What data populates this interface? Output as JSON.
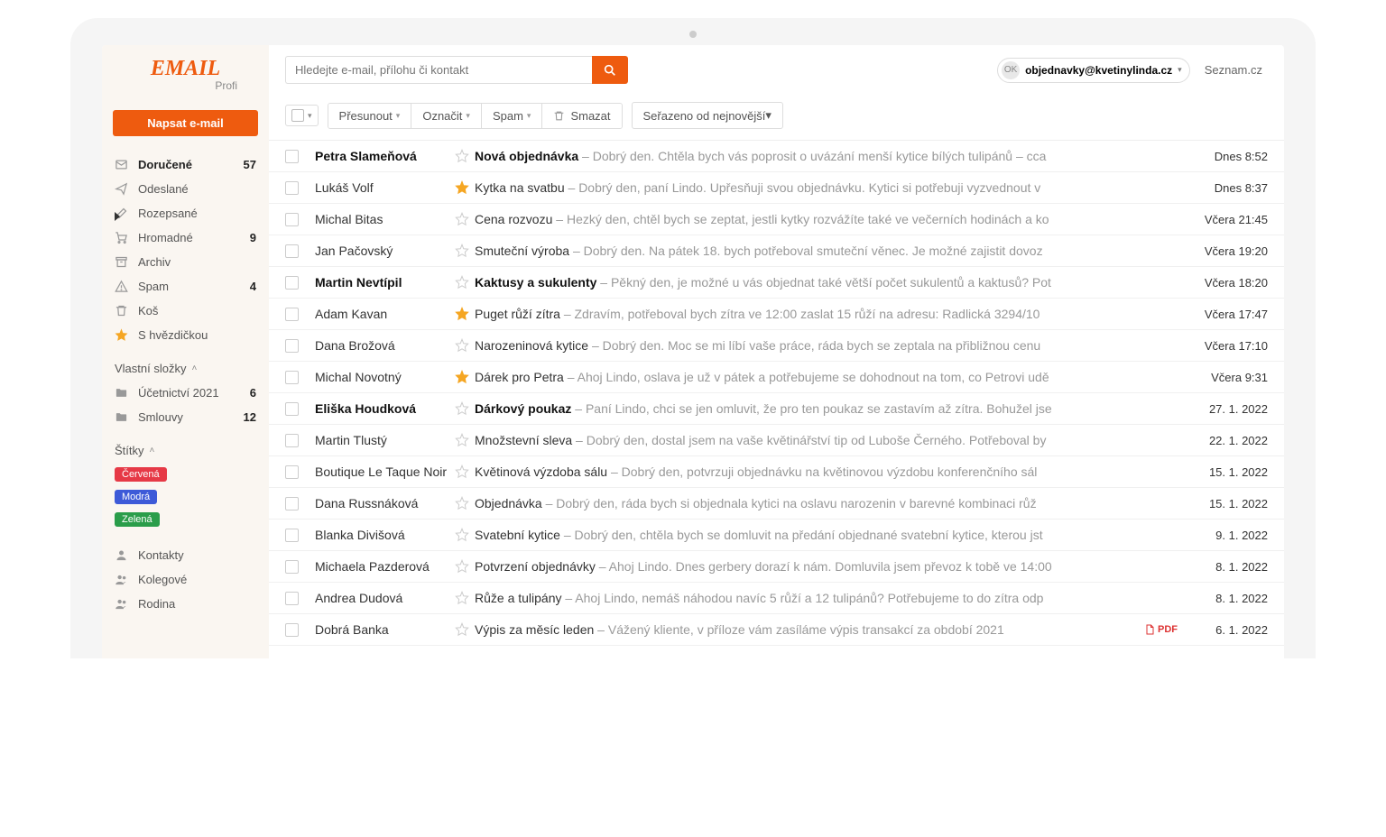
{
  "logo": {
    "main": "EMAIL",
    "sub": "Profi"
  },
  "compose": "Napsat e-mail",
  "search": {
    "placeholder": "Hledejte e-mail, přílohu či kontakt"
  },
  "account": {
    "badge": "OK",
    "email": "objednavky@kvetinylinda.cz"
  },
  "brand_link": "Seznam.cz",
  "toolbar": {
    "move": "Přesunout",
    "mark": "Označit",
    "spam": "Spam",
    "delete": "Smazat",
    "sort": "Seřazeno od nejnovější"
  },
  "folders": [
    {
      "icon": "inbox",
      "label": "Doručené",
      "count": "57",
      "active": true
    },
    {
      "icon": "sent",
      "label": "Odeslané"
    },
    {
      "icon": "draft",
      "label": "Rozepsané"
    },
    {
      "icon": "bulk",
      "label": "Hromadné",
      "count": "9"
    },
    {
      "icon": "archive",
      "label": "Archiv"
    },
    {
      "icon": "spam",
      "label": "Spam",
      "count": "4"
    },
    {
      "icon": "trash",
      "label": "Koš"
    },
    {
      "icon": "star",
      "label": "S hvězdičkou"
    }
  ],
  "custom_folders_head": "Vlastní složky",
  "custom_folders": [
    {
      "label": "Účetnictví 2021",
      "count": "6"
    },
    {
      "label": "Smlouvy",
      "count": "12"
    }
  ],
  "tags_head": "Štítky",
  "tags": [
    {
      "label": "Červená",
      "color": "#e63946"
    },
    {
      "label": "Modrá",
      "color": "#3d5ad8"
    },
    {
      "label": "Zelená",
      "color": "#2a9d4a"
    }
  ],
  "groups": [
    {
      "icon": "person",
      "label": "Kontakty"
    },
    {
      "icon": "people",
      "label": "Kolegové"
    },
    {
      "icon": "people",
      "label": "Rodina"
    }
  ],
  "emails": [
    {
      "sender": "Petra Slameňová",
      "subject": "Nová objednávka",
      "preview": "Dobrý den. Chtěla bych vás poprosit o uvázání menší kytice bílých tulipánů – cca",
      "date": "Dnes 8:52",
      "unread": true,
      "starred": false
    },
    {
      "sender": "Lukáš Volf",
      "subject": "Kytka na svatbu",
      "preview": "Dobrý den, paní Lindo. Upřesňuji svou objednávku. Kytici si potřebuji vyzvednout v",
      "date": "Dnes 8:37",
      "unread": false,
      "starred": true
    },
    {
      "sender": "Michal Bitas",
      "subject": "Cena rozvozu",
      "preview": "Hezký den, chtěl bych se zeptat, jestli kytky rozvážíte také ve večerních hodinách a ko",
      "date": "Včera 21:45",
      "unread": false,
      "starred": false
    },
    {
      "sender": "Jan Pačovský",
      "subject": "Smuteční výroba",
      "preview": "Dobrý den. Na pátek 18. bych potřeboval smuteční věnec. Je možné zajistit dovoz",
      "date": "Včera 19:20",
      "unread": false,
      "starred": false
    },
    {
      "sender": "Martin Nevtípil",
      "subject": "Kaktusy a sukulenty",
      "preview": "Pěkný den, je možné u vás objednat také větší počet sukulentů a kaktusů? Pot",
      "date": "Včera 18:20",
      "unread": true,
      "starred": false
    },
    {
      "sender": "Adam Kavan",
      "subject": "Puget růží zítra",
      "preview": "Zdravím, potřeboval bych zítra ve 12:00 zaslat 15 růží na adresu: Radlická 3294/10",
      "date": "Včera 17:47",
      "unread": false,
      "starred": true
    },
    {
      "sender": "Dana Brožová",
      "subject": "Narozeninová kytice",
      "preview": "Dobrý den. Moc se mi líbí vaše práce, ráda bych se zeptala na přibližnou cenu",
      "date": "Včera 17:10",
      "unread": false,
      "starred": false
    },
    {
      "sender": "Michal Novotný",
      "subject": "Dárek pro Petra",
      "preview": "Ahoj Lindo, oslava je už v pátek a potřebujeme se dohodnout na tom, co Petrovi udě",
      "date": "Včera 9:31",
      "unread": false,
      "starred": true
    },
    {
      "sender": "Eliška Houdková",
      "subject": "Dárkový poukaz",
      "preview": "Paní Lindo, chci se jen omluvit, že pro ten poukaz se zastavím až zítra. Bohužel jse",
      "date": "27. 1. 2022",
      "unread": true,
      "starred": false
    },
    {
      "sender": "Martin Tlustý",
      "subject": "Množstevní sleva",
      "preview": "Dobrý den, dostal jsem na vaše květinářství tip od Luboše Černého. Potřeboval by",
      "date": "22. 1. 2022",
      "unread": false,
      "starred": false
    },
    {
      "sender": "Boutique Le Taque Noir",
      "subject": "Květinová výzdoba sálu",
      "preview": "Dobrý den, potvrzuji objednávku na květinovou výzdobu konferenčního sál",
      "date": "15. 1. 2022",
      "unread": false,
      "starred": false
    },
    {
      "sender": "Dana Russnáková",
      "subject": "Objednávka",
      "preview": "Dobrý den, ráda bych si objednala kytici na oslavu narozenin v barevné kombinaci růž",
      "date": "15. 1. 2022",
      "unread": false,
      "starred": false
    },
    {
      "sender": "Blanka Divišová",
      "subject": "Svatební kytice",
      "preview": "Dobrý den, chtěla bych se domluvit na předání objednané svatební kytice, kterou jst",
      "date": "9. 1. 2022",
      "unread": false,
      "starred": false
    },
    {
      "sender": "Michaela Pazderová",
      "subject": "Potvrzení objednávky",
      "preview": "Ahoj Lindo. Dnes gerbery dorazí k nám. Domluvila jsem převoz k tobě ve 14:00",
      "date": "8. 1. 2022",
      "unread": false,
      "starred": false
    },
    {
      "sender": "Andrea Dudová",
      "subject": "Růže a tulipány",
      "preview": "Ahoj Lindo, nemáš náhodou navíc 5 růží a 12 tulipánů? Potřebujeme to do zítra odp",
      "date": "8. 1. 2022",
      "unread": false,
      "starred": false
    },
    {
      "sender": "Dobrá Banka",
      "subject": "Výpis za měsíc leden",
      "preview": "Vážený kliente, v příloze vám zasíláme výpis transakcí za období 2021",
      "date": "6. 1. 2022",
      "unread": false,
      "starred": false,
      "attachment": "PDF"
    }
  ]
}
